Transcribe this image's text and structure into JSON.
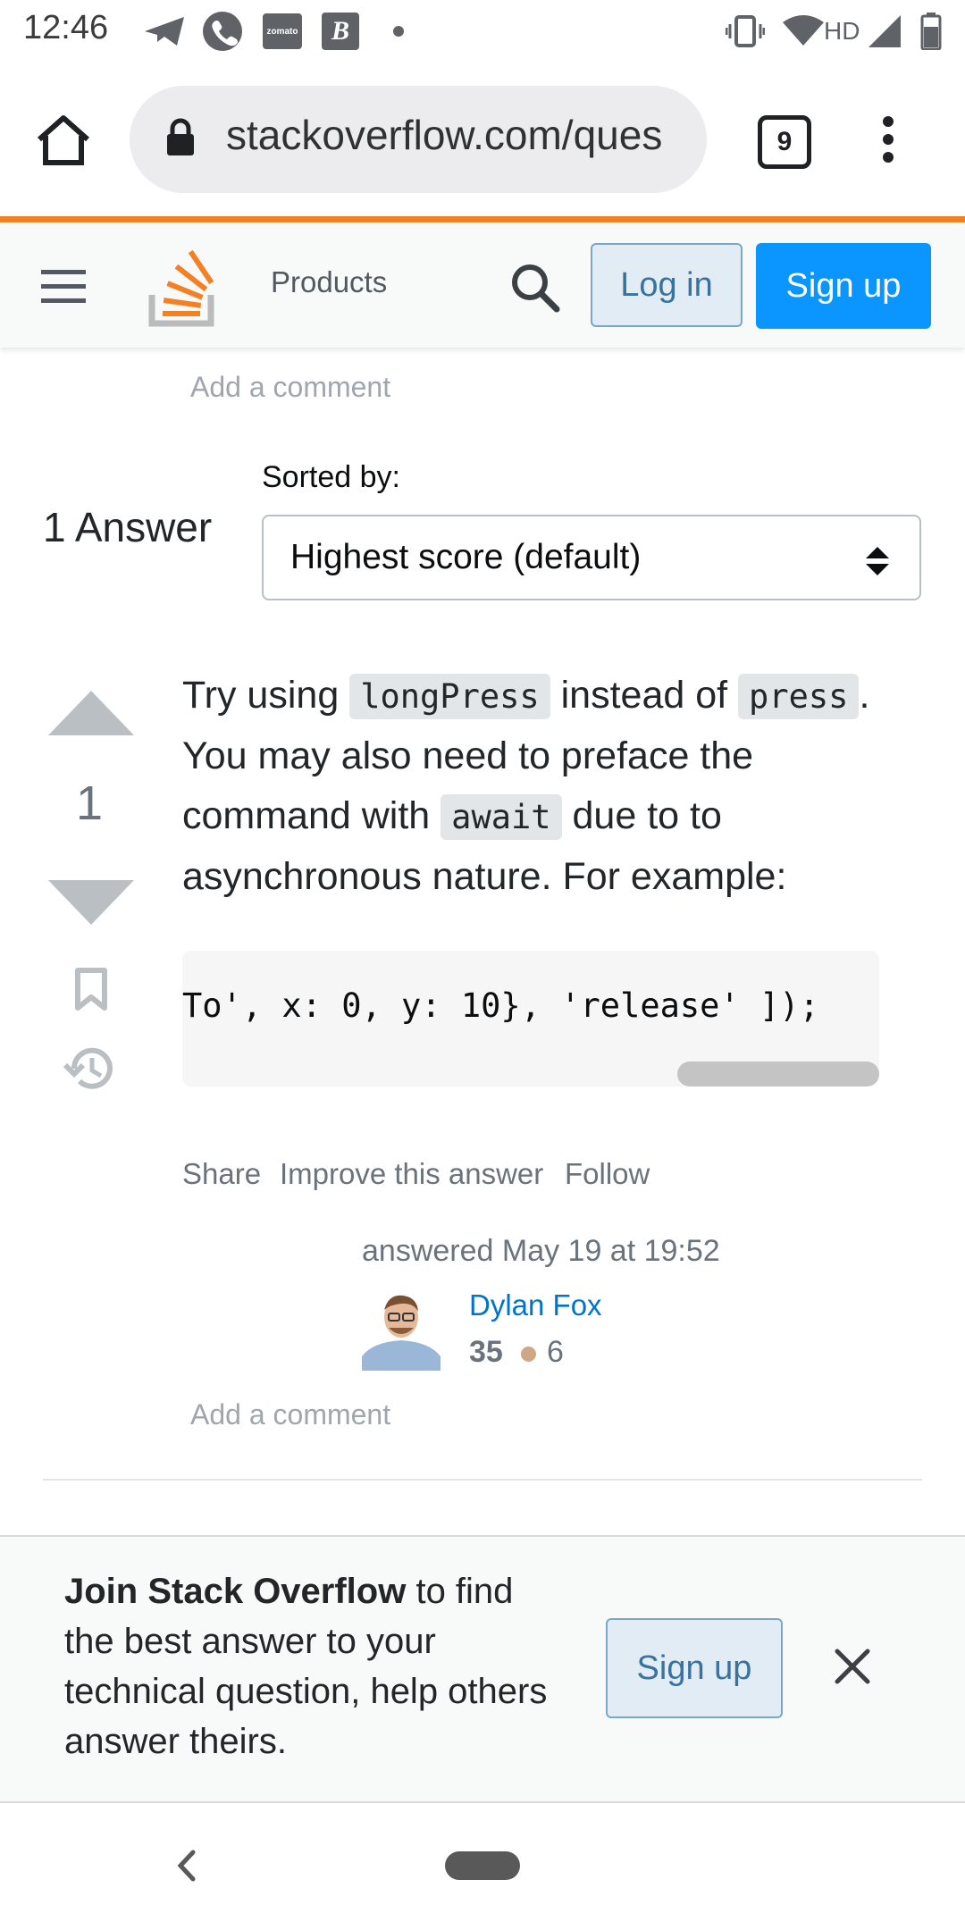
{
  "status_bar": {
    "time": "12:46",
    "icons_left": [
      "telegram-icon",
      "phone-icon",
      "zomato-icon",
      "b-app-icon",
      "dot-icon"
    ],
    "icons_right": [
      "vibrate-icon",
      "wifi-icon",
      "hd-label",
      "signal-icon",
      "battery-icon"
    ],
    "hd_label": "HD"
  },
  "browser": {
    "url": "stackoverflow.com/ques",
    "tab_count": "9"
  },
  "header": {
    "products": "Products",
    "login": "Log in",
    "signup": "Sign up"
  },
  "top_comment": {
    "add_comment": "Add a comment"
  },
  "answers": {
    "count_label": "1 Answer",
    "sorted_by_label": "Sorted by:",
    "sort_selected": "Highest score (default)"
  },
  "answer": {
    "vote_count": "1",
    "text": {
      "p1": "Try using ",
      "code1": "longPress",
      "p2": " instead of ",
      "code2": "press",
      "p3": ". You may also need to preface the command with ",
      "code3": "await",
      "p4": " due to to asynchronous nature. For example:"
    },
    "code_visible": "To', x: 0, y: 10}, 'release' ]);",
    "menu": {
      "share": "Share",
      "improve": "Improve this answer",
      "follow": "Follow"
    },
    "answered": "answered May 19 at 19:52",
    "user": {
      "name": "Dylan Fox",
      "reputation": "35",
      "bronze": "6"
    },
    "add_comment": "Add a comment"
  },
  "join_banner": {
    "bold": "Join Stack Overflow",
    "rest": " to find the best answer to your technical question, help others answer theirs.",
    "signup": "Sign up"
  },
  "colors": {
    "orange_accent": "#f48024",
    "primary_blue": "#0a95ff",
    "link_blue": "#0074cc",
    "bronze": "#d1a684"
  }
}
